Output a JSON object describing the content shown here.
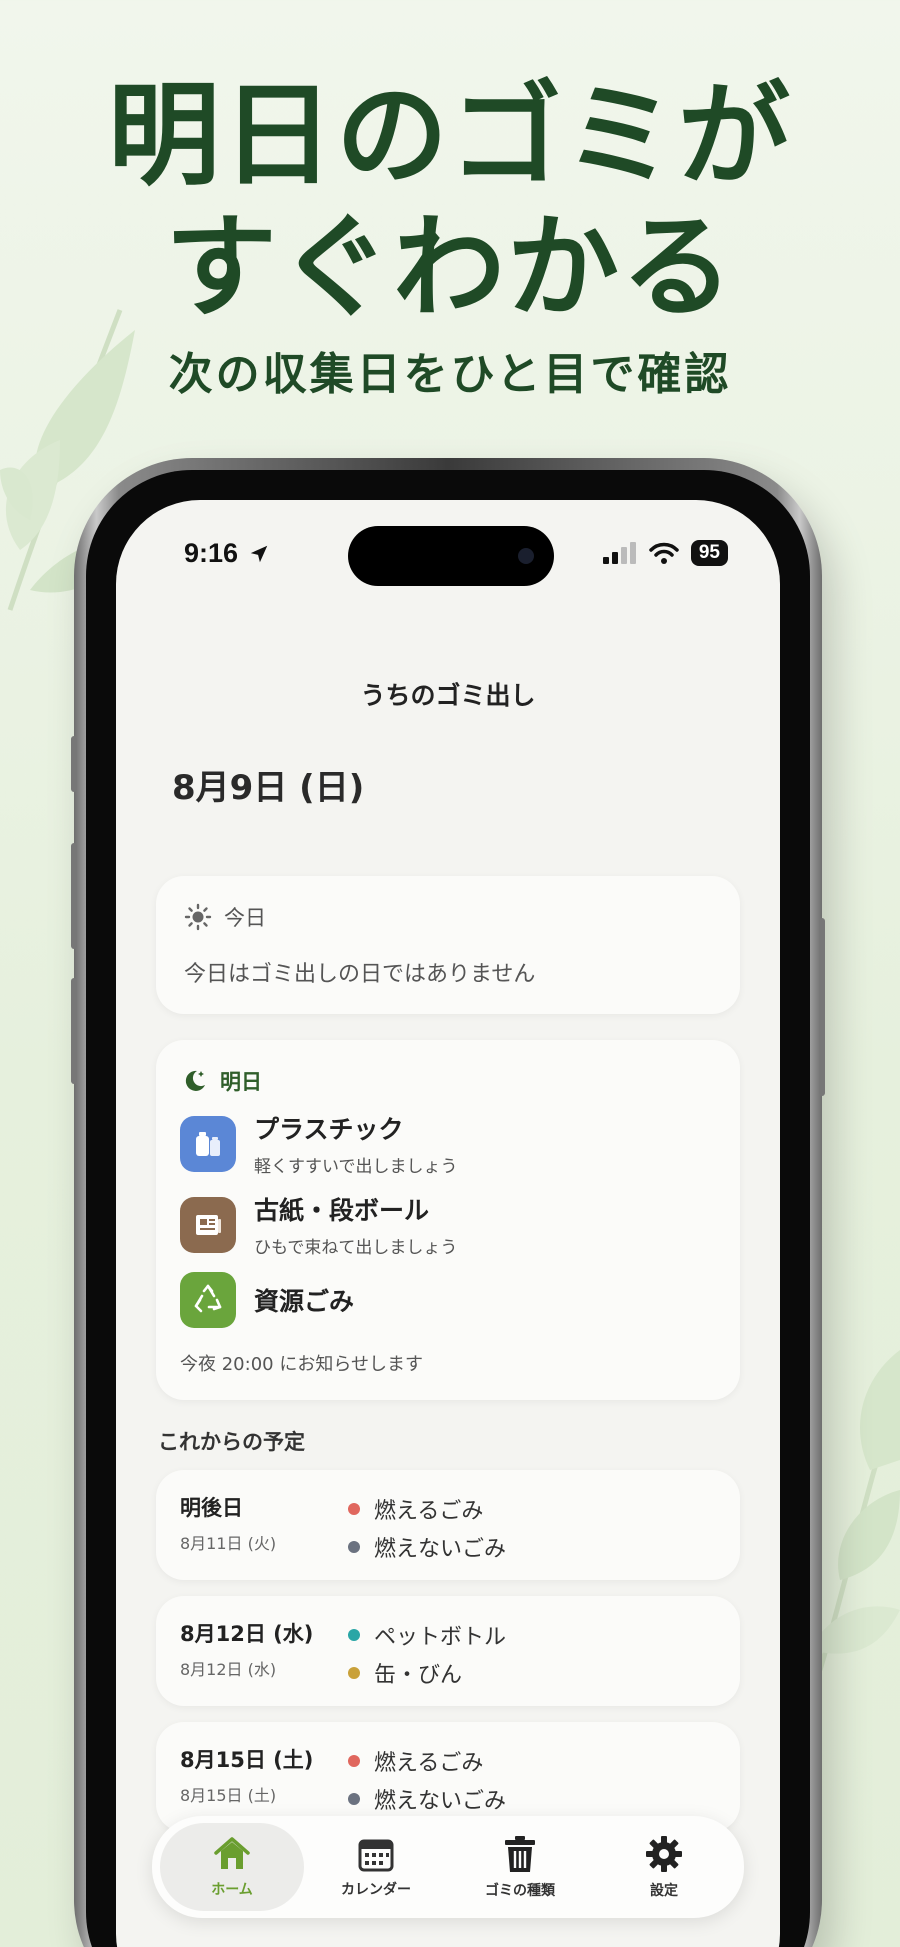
{
  "hero": {
    "title_line1": "明日のゴミが",
    "title_line2": "すぐわかる",
    "subtitle": "次の収集日をひと目で確認"
  },
  "status_bar": {
    "time": "9:16",
    "battery": "95"
  },
  "app": {
    "title": "うちのゴミ出し",
    "date_heading": "8月9日 (日)"
  },
  "today": {
    "label": "今日",
    "message": "今日はゴミ出しの日ではありません"
  },
  "tomorrow": {
    "label": "明日",
    "items": [
      {
        "name": "プラスチック",
        "note": "軽くすすいで出しましょう",
        "icon": "plastic-bottle-icon",
        "color": "#5b87d6"
      },
      {
        "name": "古紙・段ボール",
        "note": "ひもで束ねて出しましょう",
        "icon": "newspaper-icon",
        "color": "#8b6a4f"
      },
      {
        "name": "資源ごみ",
        "note": "",
        "icon": "recycle-icon",
        "color": "#6aa53c"
      }
    ],
    "notification": "今夜 20:00 にお知らせします"
  },
  "upcoming": {
    "label": "これからの予定",
    "days": [
      {
        "day": "明後日",
        "sub": "8月11日 (火)",
        "items": [
          {
            "name": "燃えるごみ",
            "color": "#e0675e"
          },
          {
            "name": "燃えないごみ",
            "color": "#6b7280"
          }
        ]
      },
      {
        "day": "8月12日 (水)",
        "sub": "8月12日 (水)",
        "items": [
          {
            "name": "ペットボトル",
            "color": "#2aa6a6"
          },
          {
            "name": "缶・びん",
            "color": "#c9a13a"
          }
        ]
      },
      {
        "day": "8月15日 (土)",
        "sub": "8月15日 (土)",
        "items": [
          {
            "name": "燃えるごみ",
            "color": "#e0675e"
          },
          {
            "name": "燃えないごみ",
            "color": "#6b7280"
          }
        ]
      }
    ]
  },
  "tabbar": {
    "tabs": [
      {
        "label": "ホーム",
        "icon": "home-icon",
        "active": true
      },
      {
        "label": "カレンダー",
        "icon": "calendar-icon",
        "active": false
      },
      {
        "label": "ゴミの種類",
        "icon": "trash-can-icon",
        "active": false
      },
      {
        "label": "設定",
        "icon": "gear-icon",
        "active": false
      }
    ]
  },
  "colors": {
    "accent": "#6a9e2f",
    "hero_text": "#1f4a26",
    "background": "#e6f0dd"
  }
}
